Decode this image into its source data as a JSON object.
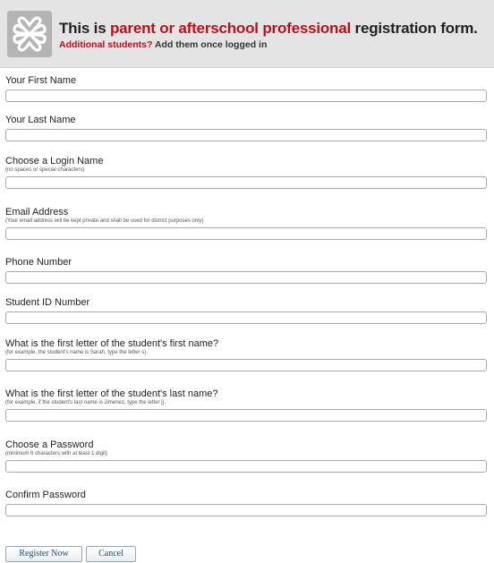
{
  "header": {
    "title_before": "This is ",
    "title_accent": "parent or afterschool professional",
    "title_after": " registration form.",
    "subtitle_accent": "Additional students?",
    "subtitle_rest": " Add them once logged in",
    "accent_color": "#b5121b",
    "logo_icon": "interlocking-loops-icon"
  },
  "form": {
    "first_name": {
      "label": "Your First Name",
      "value": ""
    },
    "last_name": {
      "label": "Your Last Name",
      "value": ""
    },
    "login_name": {
      "label": "Choose a Login Name",
      "hint": "(no spaces or special characters)",
      "value": ""
    },
    "email": {
      "label": "Email Address",
      "hint": "(Your email address will be kept private and shall be used for district purposes only)",
      "value": ""
    },
    "phone": {
      "label": "Phone Number",
      "value": ""
    },
    "student_id": {
      "label": "Student ID Number",
      "value": ""
    },
    "first_letter_first": {
      "label": "What is the first letter of the student's first name?",
      "hint": "(for example, the student's name is Sarah, type the letter s).",
      "value": ""
    },
    "first_letter_last": {
      "label": "What is the first letter of the student's last name?",
      "hint": "(for example, if the student's last name is Jimenez, type the letter j).",
      "value": ""
    },
    "password": {
      "label": "Choose a Password",
      "hint": "(minimum 6 characters with at least 1 digit)",
      "value": ""
    },
    "confirm_password": {
      "label": "Confirm Password",
      "value": ""
    }
  },
  "actions": {
    "register_label": "Register Now",
    "cancel_label": "Cancel"
  }
}
